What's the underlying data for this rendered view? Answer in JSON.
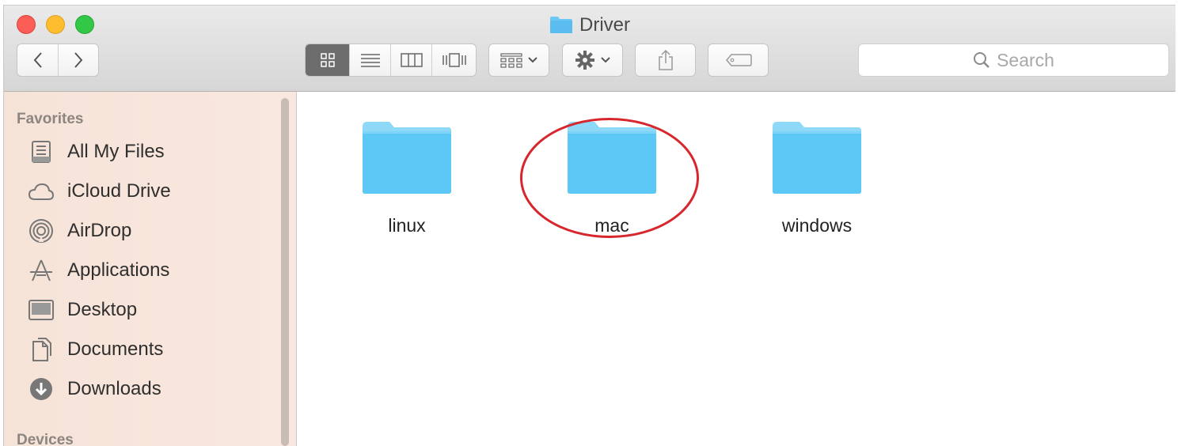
{
  "window": {
    "title": "Driver",
    "title_icon": "folder-icon"
  },
  "toolbar": {
    "back_icon": "chevron-left-icon",
    "forward_icon": "chevron-right-icon",
    "view_modes": [
      "icon-view-icon",
      "list-view-icon",
      "column-view-icon",
      "cover-flow-icon"
    ],
    "active_view": "icon-view",
    "arrange_icon": "arrange-grid-icon",
    "action_icon": "gear-icon",
    "share_icon": "share-icon",
    "tag_icon": "tag-icon",
    "search_placeholder": "Search"
  },
  "sidebar": {
    "favorites_header": "Favorites",
    "favorites": [
      {
        "label": "All My Files",
        "icon": "all-files-icon"
      },
      {
        "label": "iCloud Drive",
        "icon": "cloud-icon"
      },
      {
        "label": "AirDrop",
        "icon": "airdrop-icon"
      },
      {
        "label": "Applications",
        "icon": "applications-icon"
      },
      {
        "label": "Desktop",
        "icon": "desktop-icon"
      },
      {
        "label": "Documents",
        "icon": "documents-icon"
      },
      {
        "label": "Downloads",
        "icon": "download-icon"
      }
    ],
    "devices_header": "Devices"
  },
  "content": {
    "folders": [
      {
        "name": "linux"
      },
      {
        "name": "mac",
        "highlighted": true
      },
      {
        "name": "windows"
      }
    ]
  },
  "colors": {
    "folder_blue": "#5cc8f5",
    "highlight_ring": "#d7262c",
    "sidebar_bg": "#f7e5db"
  }
}
